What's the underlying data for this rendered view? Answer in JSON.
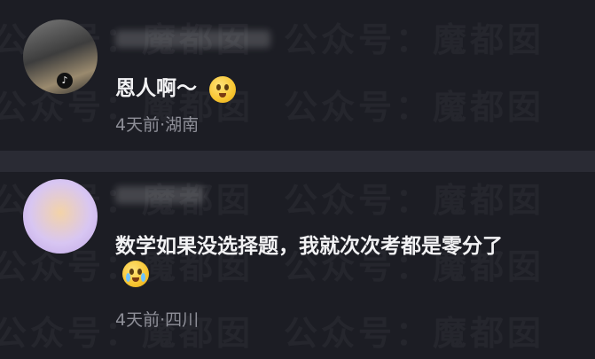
{
  "watermark": {
    "text": "公众号：魔都囡",
    "color": "#ffffff"
  },
  "comments": [
    {
      "text": "恩人啊～",
      "emoji": "pleading-face-hands-emoji",
      "meta": "4天前·湖南"
    },
    {
      "text": "数学如果没选择题，我就次次考都是零分了",
      "emoji": "teary-face-emoji",
      "meta": "4天前·四川"
    }
  ],
  "colors": {
    "background": "#1c1d24",
    "divider": "#2a2b34",
    "comment_text": "#f2f2f4",
    "meta_text": "#8e8f98"
  }
}
